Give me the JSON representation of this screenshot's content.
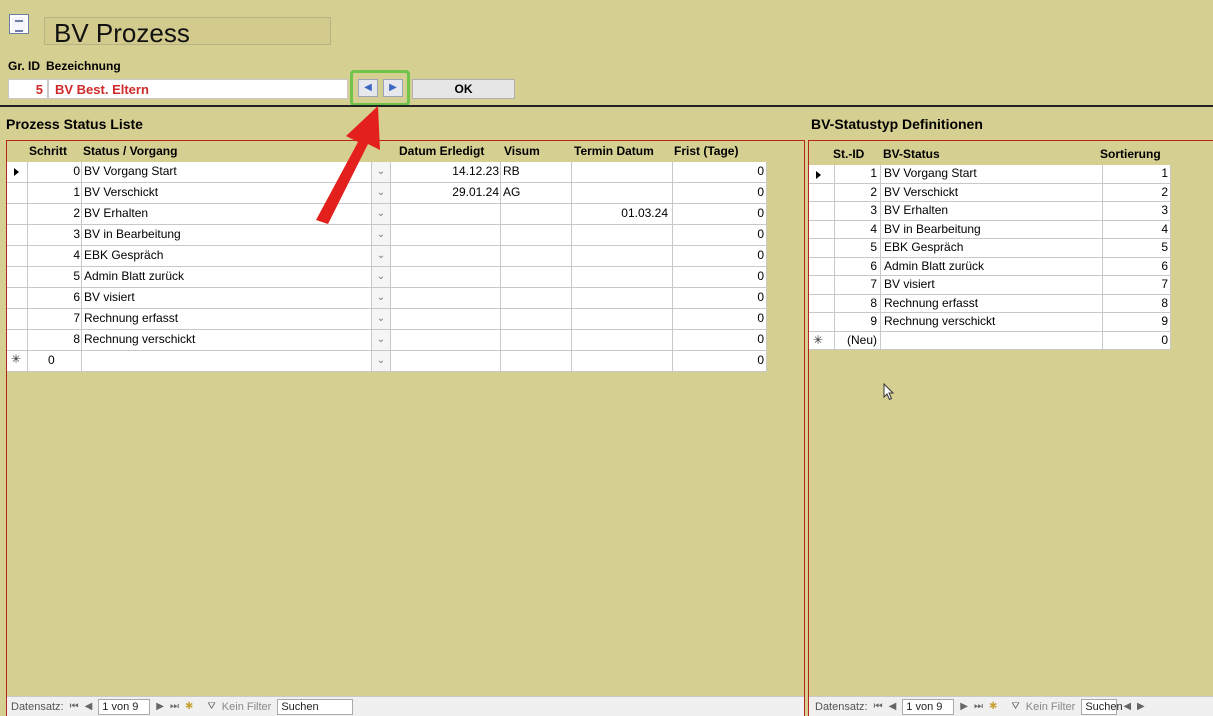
{
  "header": {
    "title": "BV Prozess",
    "gr_id_label": "Gr. ID",
    "bezeichnung_label": "Bezeichnung",
    "gr_id_value": "5",
    "bezeichnung_value": "BV Best. Eltern",
    "ok_label": "OK",
    "nav_prev": "◀",
    "nav_next": "▶"
  },
  "process_list": {
    "title": "Prozess Status Liste",
    "columns": {
      "schritt": "Schritt",
      "status": "Status / Vorgang",
      "datum": "Datum Erledigt",
      "visum": "Visum",
      "termin": "Termin Datum",
      "frist": "Frist (Tage)"
    },
    "rows": [
      {
        "schritt": "0",
        "status": "BV Vorgang Start",
        "datum": "14.12.23",
        "visum": "RB",
        "termin": "",
        "frist": "0"
      },
      {
        "schritt": "1",
        "status": "BV Verschickt",
        "datum": "29.01.24",
        "visum": "AG",
        "termin": "",
        "frist": "0"
      },
      {
        "schritt": "2",
        "status": "BV Erhalten",
        "datum": "",
        "visum": "",
        "termin": "01.03.24",
        "frist": "0"
      },
      {
        "schritt": "3",
        "status": "BV in Bearbeitung",
        "datum": "",
        "visum": "",
        "termin": "",
        "frist": "0"
      },
      {
        "schritt": "4",
        "status": "EBK Gespräch",
        "datum": "",
        "visum": "",
        "termin": "",
        "frist": "0"
      },
      {
        "schritt": "5",
        "status": "Admin Blatt zurück",
        "datum": "",
        "visum": "",
        "termin": "",
        "frist": "0"
      },
      {
        "schritt": "6",
        "status": "BV visiert",
        "datum": "",
        "visum": "",
        "termin": "",
        "frist": "0"
      },
      {
        "schritt": "7",
        "status": "Rechnung erfasst",
        "datum": "",
        "visum": "",
        "termin": "",
        "frist": "0"
      },
      {
        "schritt": "8",
        "status": "Rechnung verschickt",
        "datum": "",
        "visum": "",
        "termin": "",
        "frist": "0"
      }
    ],
    "new_row": {
      "schritt": "0",
      "frist": "0"
    },
    "statusbar": {
      "label": "Datensatz:",
      "record": "1 von 9",
      "filter": "Kein Filter",
      "search": "Suchen"
    }
  },
  "status_defs": {
    "title": "BV-Statustyp Definitionen",
    "columns": {
      "id": "St.-ID",
      "status": "BV-Status",
      "sort": "Sortierung"
    },
    "rows": [
      {
        "id": "1",
        "status": "BV Vorgang Start",
        "sort": "1"
      },
      {
        "id": "2",
        "status": "BV Verschickt",
        "sort": "2"
      },
      {
        "id": "3",
        "status": "BV Erhalten",
        "sort": "3"
      },
      {
        "id": "4",
        "status": "BV in Bearbeitung",
        "sort": "4"
      },
      {
        "id": "5",
        "status": "EBK Gespräch",
        "sort": "5"
      },
      {
        "id": "6",
        "status": "Admin Blatt zurück",
        "sort": "6"
      },
      {
        "id": "7",
        "status": "BV visiert",
        "sort": "7"
      },
      {
        "id": "8",
        "status": "Rechnung erfasst",
        "sort": "8"
      },
      {
        "id": "9",
        "status": "Rechnung verschickt",
        "sort": "9"
      }
    ],
    "new_row": {
      "id": "(Neu)",
      "sort": "0"
    },
    "statusbar": {
      "label": "Datensatz:",
      "record": "1 von 9",
      "filter": "Kein Filter",
      "search": "Suchen"
    }
  },
  "colors": {
    "background": "#d6cf92",
    "panel_border": "#b5261c",
    "highlight": "#6fc24a",
    "arrow": "#e3201b",
    "value_red": "#d02a2a"
  }
}
